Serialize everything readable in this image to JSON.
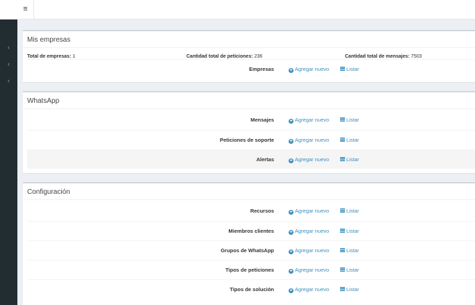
{
  "topbar": {
    "menu_icon": "≡"
  },
  "sidebar": {
    "chevrons": [
      "‹",
      "‹",
      "‹"
    ]
  },
  "sections": {
    "empresas": {
      "title": "Mis empresas",
      "totals": [
        {
          "label": "Total de empresas:",
          "value": "1"
        },
        {
          "label": "Cantidad total de peticiones:",
          "value": "236"
        },
        {
          "label": "Cantidad total de mensajes:",
          "value": "7503"
        }
      ],
      "rows": [
        {
          "label": "Empresas",
          "add": "Agregar nuevo",
          "list": "Listar"
        }
      ]
    },
    "whatsapp": {
      "title": "WhatsApp",
      "rows": [
        {
          "label": "Mensajes",
          "add": "Agregar nuevo",
          "list": "Listar"
        },
        {
          "label": "Peticiones de soporte",
          "add": "Agregar nuevo",
          "list": "Listar"
        },
        {
          "label": "Alertas",
          "add": "Agregar nuevo",
          "list": "Listar"
        }
      ]
    },
    "config": {
      "title": "Configuración",
      "rows": [
        {
          "label": "Recursos",
          "add": "Agregar nuevo",
          "list": "Listar"
        },
        {
          "label": "Miembros clientes",
          "add": "Agregar nuevo",
          "list": "Listar"
        },
        {
          "label": "Grupos de WhatsApp",
          "add": "Agregar nuevo",
          "list": "Listar"
        },
        {
          "label": "Tipos de peticiones",
          "add": "Agregar nuevo",
          "list": "Listar"
        },
        {
          "label": "Tipos de solución",
          "add": "Agregar nuevo",
          "list": "Listar"
        }
      ]
    }
  }
}
